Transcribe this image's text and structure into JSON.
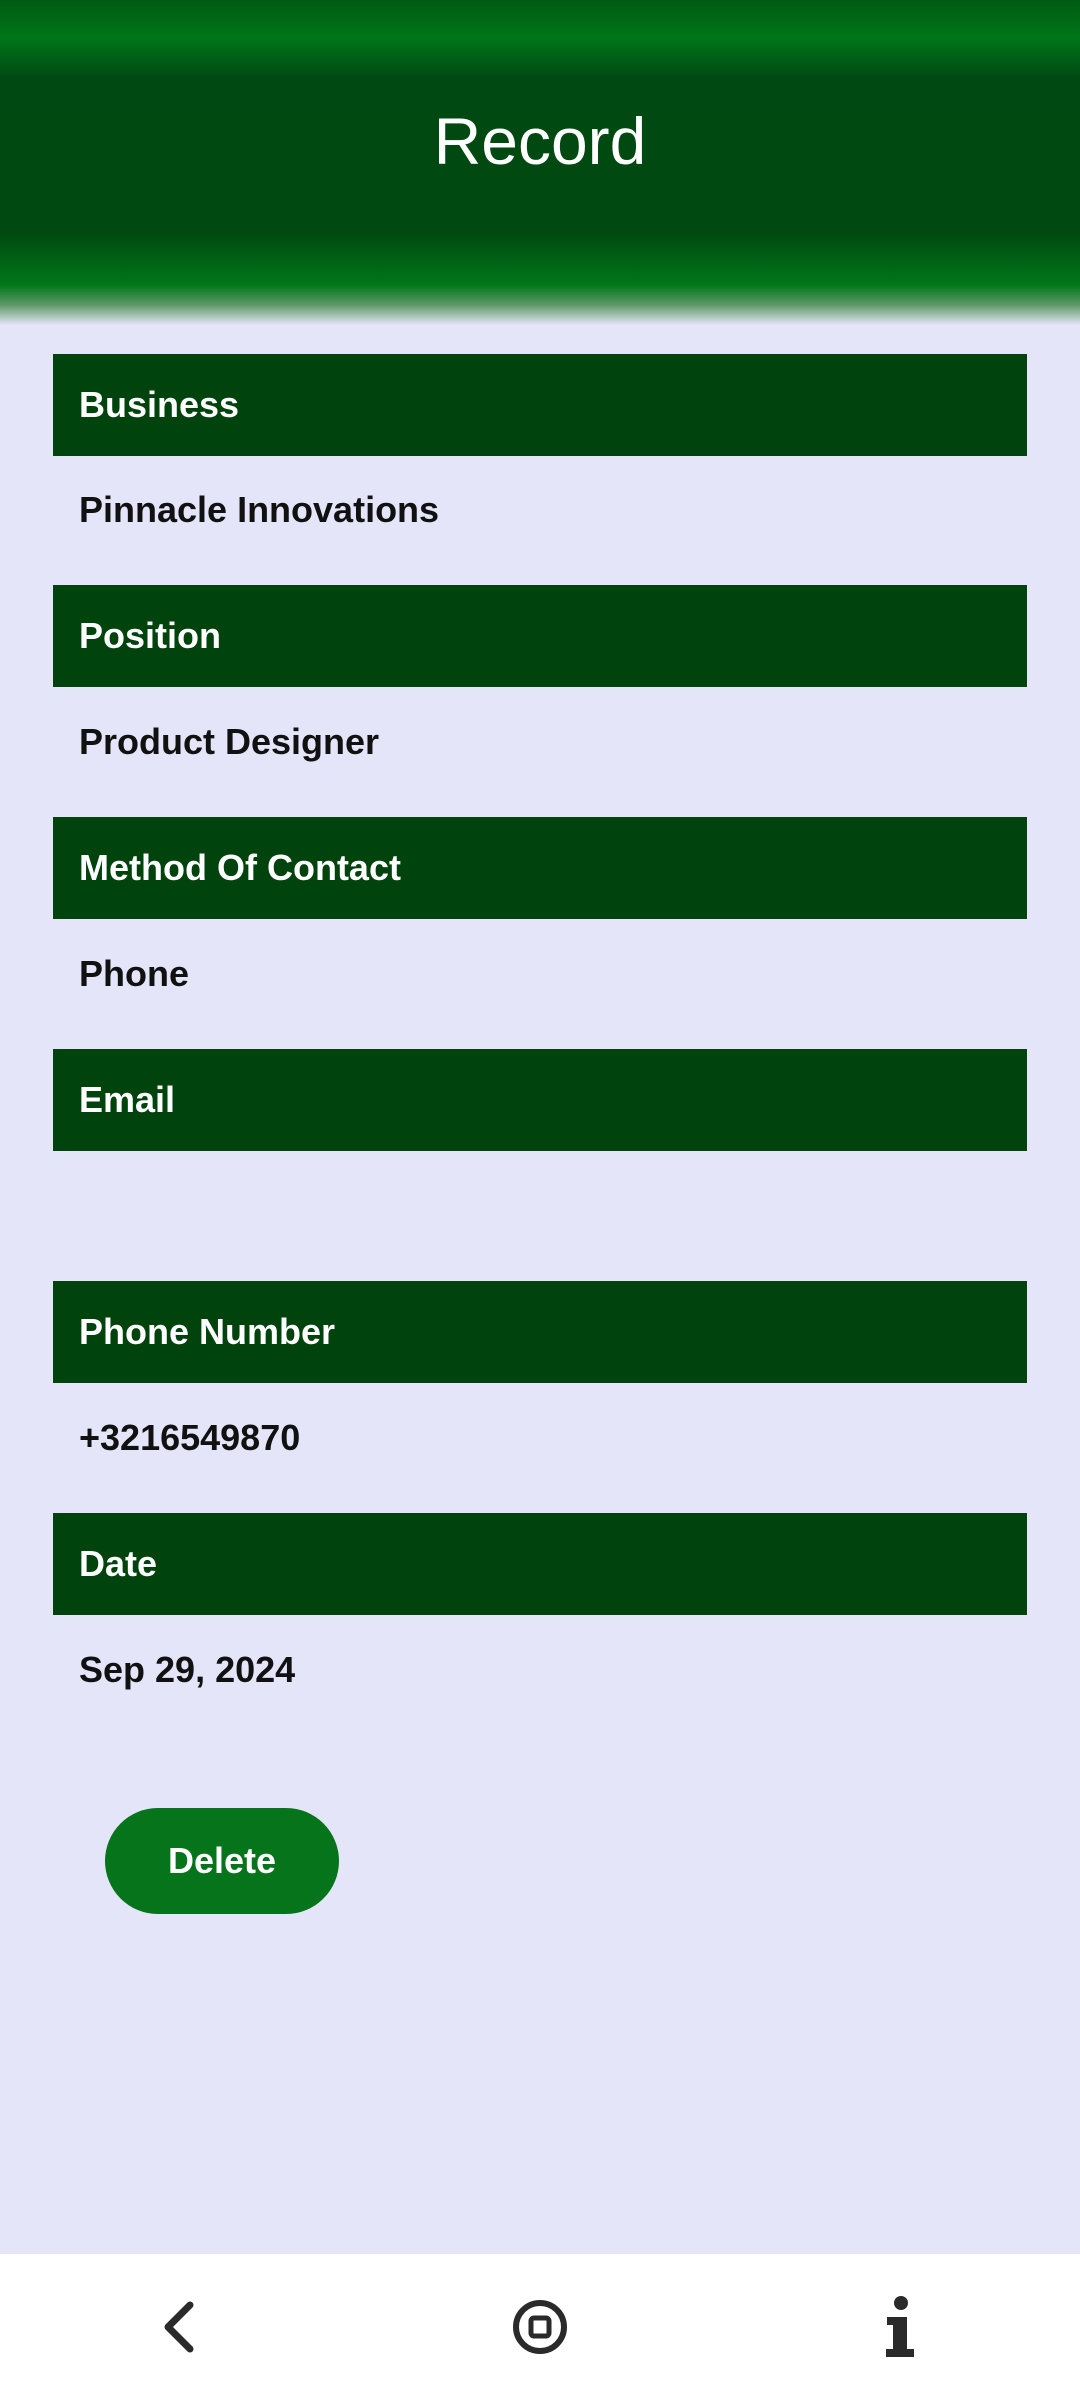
{
  "header": {
    "title": "Record"
  },
  "fields": [
    {
      "label": "Business",
      "value": "Pinnacle Innovations"
    },
    {
      "label": "Position",
      "value": "Product Designer"
    },
    {
      "label": "Method Of Contact",
      "value": "Phone"
    },
    {
      "label": "Email",
      "value": ""
    },
    {
      "label": "Phone Number",
      "value": "+3216549870"
    },
    {
      "label": "Date",
      "value": "Sep 29, 2024"
    }
  ],
  "actions": {
    "delete_label": "Delete"
  },
  "nav": {
    "icons": [
      "back-icon",
      "home-icon",
      "info-icon"
    ]
  },
  "colors": {
    "header_green": "#004910",
    "field_header_green": "#00430d",
    "button_green": "#05741a",
    "background": "#e4e5f8"
  }
}
